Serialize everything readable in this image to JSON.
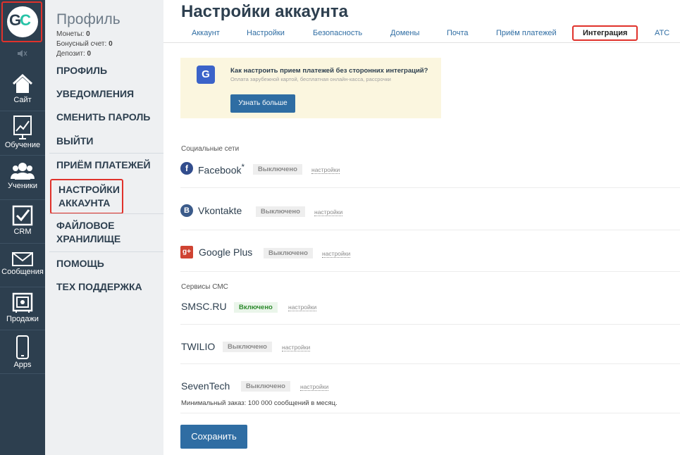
{
  "iconbar": {
    "logo": "GC",
    "items": [
      {
        "label": "Сайт",
        "icon": "house-icon"
      },
      {
        "label": "Обучение",
        "icon": "chart-icon"
      },
      {
        "label": "Ученики",
        "icon": "users-icon"
      },
      {
        "label": "CRM",
        "icon": "checkbox-icon"
      },
      {
        "label": "Сообщения",
        "icon": "envelope-icon"
      },
      {
        "label": "Продажи",
        "icon": "safe-icon"
      },
      {
        "label": "Apps",
        "icon": "phone-icon"
      }
    ]
  },
  "menu": {
    "title": "Профиль",
    "coins_label": "Монеты:",
    "coins_value": "0",
    "bonus_label": "Бонусный счет:",
    "bonus_value": "0",
    "deposit_label": "Депозит:",
    "deposit_value": "0",
    "items": [
      "ПРОФИЛЬ",
      "УВЕДОМЛЕНИЯ",
      "СМЕНИТЬ ПАРОЛЬ",
      "ВЫЙТИ",
      "ПРИЁМ ПЛАТЕЖЕЙ",
      "НАСТРОЙКИ АККАУНТА",
      "ФАЙЛОВОЕ ХРАНИЛИЩЕ",
      "ПОМОЩЬ",
      "ТЕХ ПОДДЕРЖКА"
    ]
  },
  "main": {
    "title": "Настройки аккаунта",
    "tabs": [
      "Аккаунт",
      "Настройки",
      "Безопасность",
      "Домены",
      "Почта",
      "Приём платежей",
      "Интеграция",
      "АТС"
    ],
    "active_tab": "Интеграция",
    "banner": {
      "icon": "G",
      "heading": "Как настроить прием платежей без сторонних интеграций?",
      "sub": "Оплата зарубежной картой, бесплатная онлайн-касса, рассрочки",
      "button": "Узнать больше"
    },
    "social_section": "Социальные сети",
    "sms_section": "Сервисы СМС",
    "settings_link": "настройки",
    "integrations": [
      {
        "name": "Facebook",
        "suffix": "*",
        "status": "Выключено",
        "icon": "facebook-icon",
        "glyph": "f"
      },
      {
        "name": "Vkontakte",
        "status": "Выключено",
        "icon": "vk-icon",
        "glyph": "B"
      },
      {
        "name": "Google Plus",
        "status": "Выключено",
        "icon": "google-plus-icon",
        "glyph": "g+"
      },
      {
        "name": "SMSC.RU",
        "status": "Включено"
      },
      {
        "name": "TWILIO",
        "status": "Выключено"
      },
      {
        "name": "SevenTech",
        "status": "Выключено"
      }
    ],
    "min_order_note": "Минимальный заказ: 100 000 сообщений в месяц.",
    "save_button": "Сохранить"
  },
  "colors": {
    "sidebar": "#2d3f4f",
    "accent": "#2f6da3",
    "highlight": "#e0322b",
    "brand_teal": "#27c3a7"
  }
}
